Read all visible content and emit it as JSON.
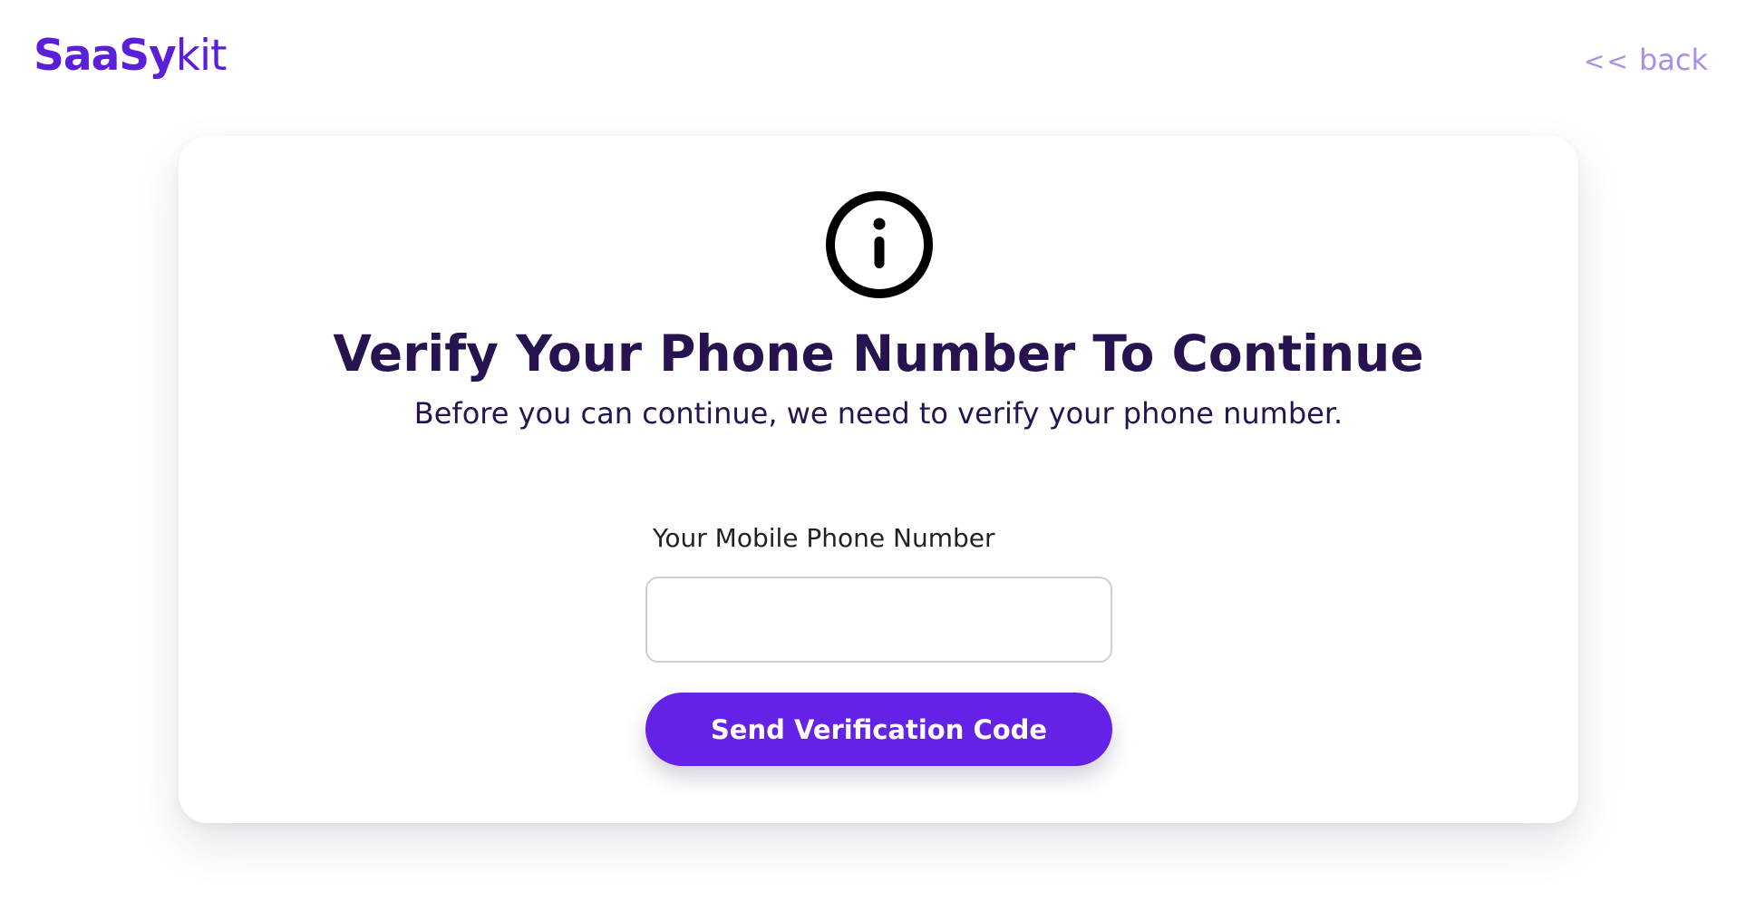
{
  "header": {
    "logo_part1": "SaaSy",
    "logo_part2": "kit",
    "back_arrows": "<<",
    "back_label": "back"
  },
  "card": {
    "icon": "info-circle-icon",
    "title": "Verify Your Phone Number To Continue",
    "subtitle": "Before you can continue, we need to verify your phone number.",
    "phone_label": "Your Mobile Phone Number",
    "phone_value": "",
    "send_button_label": "Send Verification Code"
  },
  "colors": {
    "brand": "#5b1fd9",
    "button": "#6322e5",
    "heading": "#26134f",
    "back_link": "#a98ee6"
  }
}
